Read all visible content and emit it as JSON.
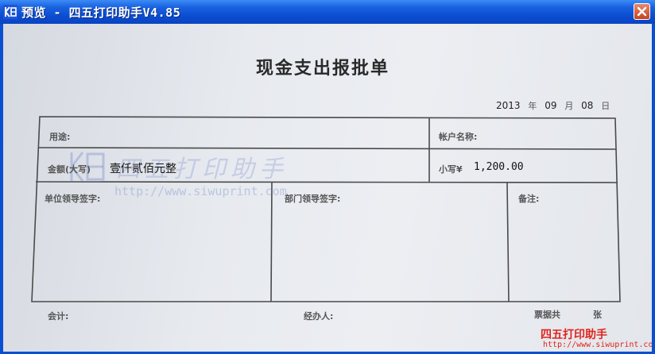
{
  "window": {
    "title": "预览 - 四五打印助手V4.85",
    "close_symbol": "✕"
  },
  "document": {
    "title": "现金支出报批单",
    "date": {
      "year": "2013",
      "year_label": "年",
      "month": "09",
      "month_label": "月",
      "day": "08",
      "day_label": "日"
    },
    "fields": {
      "purpose_label": "用途:",
      "account_name_label": "帐户名称:",
      "amount_upper_label": "金额(大写)",
      "amount_upper_value": "壹仟贰佰元整",
      "amount_lower_label": "小写¥",
      "amount_lower_value": "1,200.00",
      "unit_leader_label": "单位领导签字:",
      "dept_leader_label": "部门领导签字:",
      "remarks_label": "备注:",
      "accountant_label": "会计:",
      "handler_label": "经办人:",
      "attachments_label": "票据共",
      "sheets_label": "张"
    }
  },
  "watermark": {
    "text": "四五打印助手",
    "url": "http://www.siwuprint.com"
  },
  "corner_brand": {
    "name": "四五打印助手",
    "url": "http://www.siwuprint.com"
  },
  "colors": {
    "titlebar": "#0a4cd0",
    "accent_red": "#e0241c",
    "watermark_blue": "#6e82c8"
  },
  "icons": [
    "app-icon",
    "close-icon"
  ]
}
